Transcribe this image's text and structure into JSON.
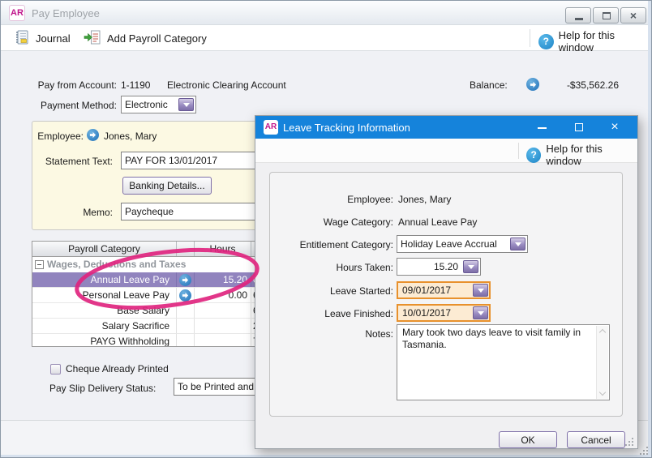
{
  "window": {
    "title": "Pay Employee",
    "logo": "AR"
  },
  "icons": {
    "help": "?",
    "close": "×",
    "logo": "AR"
  },
  "toolbar": {
    "journal": "Journal",
    "add_payroll_category": "Add Payroll Category",
    "help": "Help for this window"
  },
  "account": {
    "label": "Pay from Account:",
    "number": "1-1190",
    "name": "Electronic Clearing Account",
    "balance_label": "Balance:",
    "balance_value": "-$35,562.26"
  },
  "payment": {
    "label": "Payment Method:",
    "value": "Electronic"
  },
  "employee_box": {
    "employee_label": "Employee:",
    "employee_value": "Jones, Mary",
    "statement_label": "Statement Text:",
    "statement_value": "PAY FOR 13/01/2017",
    "banking_button": "Banking Details...",
    "memo_label": "Memo:",
    "memo_value": "Paycheque"
  },
  "table": {
    "header_category": "Payroll Category",
    "header_hours": "Hours",
    "group": "Wages, Deductions and Taxes",
    "rows": [
      {
        "category": "Annual Leave Pay",
        "hours": "15.20",
        "amount_partial": "0"
      },
      {
        "category": "Personal Leave Pay",
        "hours": "0.00",
        "amount_partial": "6"
      },
      {
        "category": "Base Salary",
        "hours": "",
        "amount_partial": "6"
      },
      {
        "category": "Salary Sacrifice",
        "hours": "",
        "amount_partial": "2"
      },
      {
        "category": "PAYG Withholding",
        "hours": "",
        "amount_partial": "7"
      }
    ]
  },
  "footer": {
    "cheque_checkbox_label": "Cheque Already Printed",
    "payslip_label": "Pay Slip Delivery Status:",
    "payslip_value": "To be Printed and Emailed"
  },
  "dialog": {
    "title": "Leave Tracking Information",
    "logo": "AR",
    "help": "Help for this window",
    "employee_label": "Employee:",
    "employee_value": "Jones, Mary",
    "wage_label": "Wage Category:",
    "wage_value": "Annual Leave Pay",
    "entitlement_label": "Entitlement Category:",
    "entitlement_value": "Holiday Leave Accrual",
    "hours_label": "Hours Taken:",
    "hours_value": "15.20",
    "started_label": "Leave Started:",
    "started_value": "09/01/2017",
    "finished_label": "Leave Finished:",
    "finished_value": "10/01/2017",
    "notes_label": "Notes:",
    "notes_value": "Mary took two days leave to visit family in Tasmania.",
    "ok": "OK",
    "cancel": "Cancel"
  },
  "colors": {
    "dialog_titlebar_blue": "#1583DB",
    "brand_magenta": "#C0168C",
    "selection_purple": "#9184BE",
    "annotation_pink": "#E0257F",
    "date_highlight_border": "#E8912D",
    "date_highlight_bg": "#FCEBD3",
    "accent_purple": "#7E6FA8"
  }
}
